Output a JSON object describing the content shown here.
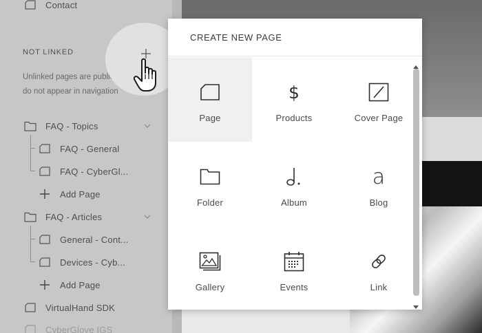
{
  "sidebar": {
    "top_item": {
      "label": "Contact",
      "icon": "page-icon"
    },
    "section_title": "NOT LINKED",
    "section_desc_line1": "Unlinked pages are public, b",
    "section_desc_line2": "do not appear in navigation",
    "plus_icon": "plus-icon",
    "items": [
      {
        "label": "FAQ - Topics",
        "icon": "folder-icon"
      },
      {
        "label": "FAQ - General",
        "icon": "page-icon"
      },
      {
        "label": "FAQ - CyberGl...",
        "icon": "page-icon"
      },
      {
        "label": "Add Page",
        "icon": "plus-icon"
      },
      {
        "label": "FAQ - Articles",
        "icon": "folder-icon"
      },
      {
        "label": "General - Cont...",
        "icon": "page-icon"
      },
      {
        "label": "Devices - Cyb...",
        "icon": "page-icon"
      },
      {
        "label": "Add Page",
        "icon": "plus-icon"
      },
      {
        "label": "VirtualHand SDK",
        "icon": "page-icon"
      },
      {
        "label": "CyberGlove IGS",
        "icon": "page-icon"
      }
    ]
  },
  "modal": {
    "title": "CREATE NEW PAGE",
    "tiles": [
      {
        "label": "Page",
        "icon": "page-icon",
        "selected": true
      },
      {
        "label": "Products",
        "icon": "dollar-icon"
      },
      {
        "label": "Cover Page",
        "icon": "cover-page-icon"
      },
      {
        "label": "Folder",
        "icon": "folder-icon"
      },
      {
        "label": "Album",
        "icon": "music-note-icon"
      },
      {
        "label": "Blog",
        "icon": "blog-icon"
      },
      {
        "label": "Gallery",
        "icon": "gallery-icon"
      },
      {
        "label": "Events",
        "icon": "calendar-icon"
      },
      {
        "label": "Link",
        "icon": "link-icon"
      }
    ]
  },
  "colors": {
    "sidebar_bg": "#c7c7c7",
    "modal_bg": "#ffffff",
    "selected_tile_bg": "#f0f0f0",
    "text": "#4a4a4a"
  }
}
